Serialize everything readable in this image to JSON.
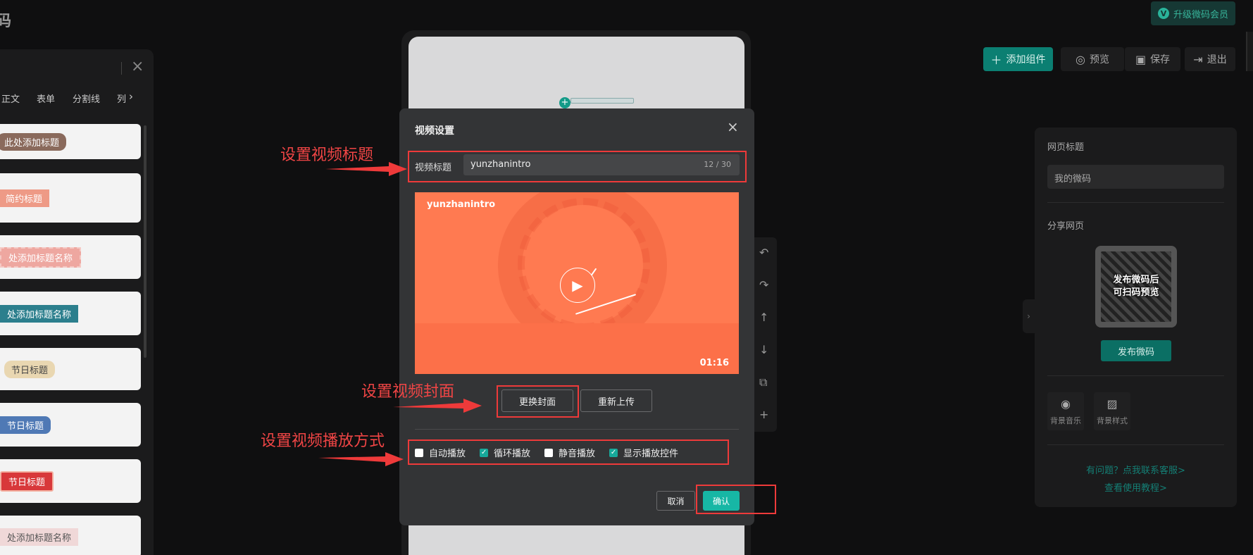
{
  "app": {
    "title_char": "码",
    "upgrade_label": "升级微码会员",
    "upgrade_badge": "V"
  },
  "toolbar": {
    "add_label": "添加组件",
    "preview_label": "预览",
    "save_label": "保存",
    "exit_label": "退出"
  },
  "left_panel": {
    "tabs": [
      "正文",
      "表单",
      "分割线",
      "列"
    ],
    "templates": [
      {
        "label": "此处添加标题",
        "color": "#8a6a5c"
      },
      {
        "label": "简约标题",
        "color": "#ee9a86"
      },
      {
        "label": "处添加标题名称",
        "color": "#eea7a0"
      },
      {
        "label": "处添加标题名称",
        "color": "#2c7f8d"
      },
      {
        "label": "节日标题",
        "color": "#e9d7b1"
      },
      {
        "label": "节日标题",
        "color": "#4f79b5"
      },
      {
        "label": "节日标题",
        "color": "#d8383a"
      },
      {
        "label": "处添加标题名称",
        "color": "#f0d8d8"
      }
    ]
  },
  "right_panel": {
    "page_title_label": "网页标题",
    "page_title_value": "我的微码",
    "share_label": "分享网页",
    "qr_text_line1": "发布微码后",
    "qr_text_line2": "可扫码预览",
    "publish_label": "发布微码",
    "bg_music_label": "背景音乐",
    "bg_style_label": "背景样式",
    "help_link": "有问题？点我联系客服>",
    "tutorial_link": "查看使用教程>"
  },
  "dialog": {
    "title": "视频设置",
    "field_label": "视频标题",
    "title_value": "yunzhanintro",
    "title_count": "12 / 30",
    "video_overlay_title": "yunzhanintro",
    "video_duration": "01:16",
    "change_cover_label": "更换封面",
    "reupload_label": "重新上传",
    "options": [
      {
        "label": "自动播放",
        "checked": false
      },
      {
        "label": "循环播放",
        "checked": true
      },
      {
        "label": "静音播放",
        "checked": false
      },
      {
        "label": "显示播放控件",
        "checked": true
      }
    ],
    "cancel_label": "取消",
    "confirm_label": "确认"
  },
  "annotations": {
    "title_note": "设置视频标题",
    "cover_note": "设置视频封面",
    "playback_note": "设置视频播放方式",
    "color": "#ee3a3a"
  }
}
